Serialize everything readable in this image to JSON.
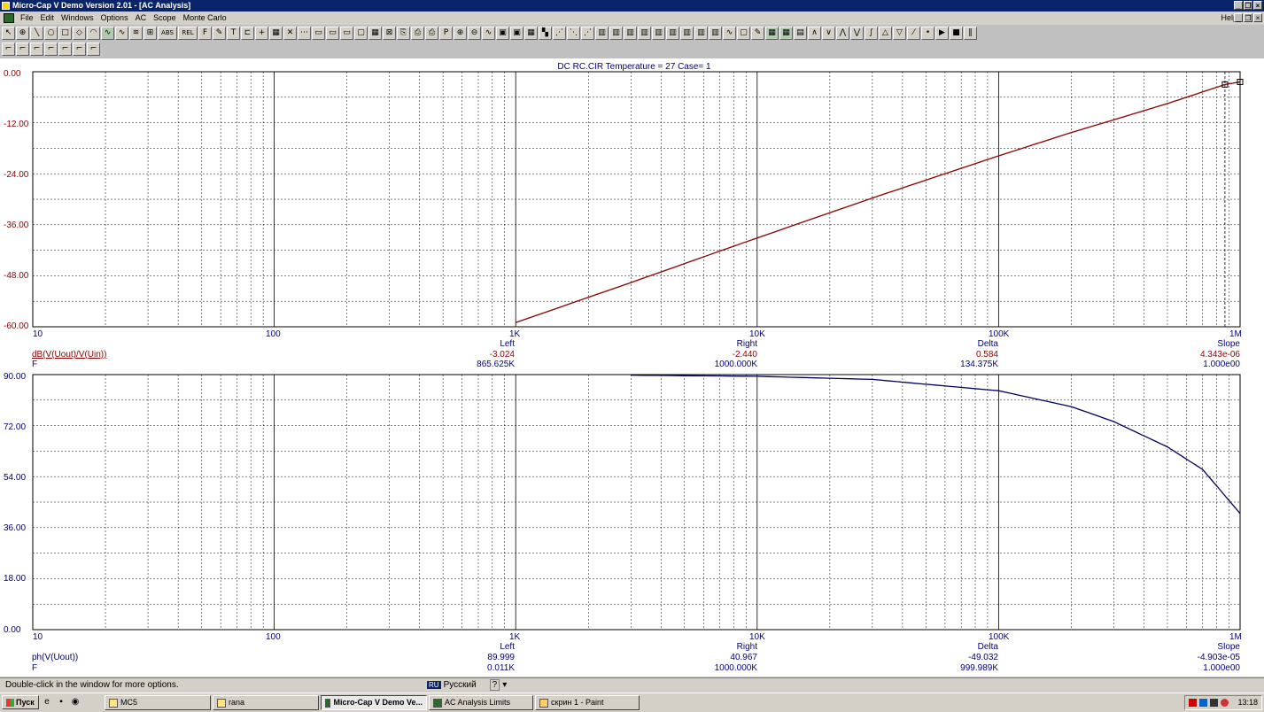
{
  "window": {
    "title": "Micro-Cap V Demo Version 2.01 - [AC Analysis]"
  },
  "menu": {
    "items": [
      "File",
      "Edit",
      "Windows",
      "Options",
      "AC",
      "Scope",
      "Monte Carlo"
    ],
    "help": "Help"
  },
  "toolbar": {
    "row1_icons": [
      "select-icon",
      "component-icon",
      "wire-icon",
      "circle-icon",
      "rect-icon",
      "diamond-icon",
      "arc-icon",
      "ac-icon",
      "wave-icon",
      "active-icon",
      "graph-icon",
      "abs-icon",
      "rel-icon",
      "f-icon",
      "pen-icon",
      "text-icon",
      "step-icon",
      "plus-icon",
      "grid-icon",
      "cross-icon",
      "dots-icon",
      "panel-icon",
      "panel2-icon",
      "panel3-icon",
      "frame-icon",
      "grid2-icon",
      "delete-icon",
      "copy-icon",
      "print-icon",
      "printer2-icon",
      "p-icon",
      "zoom-in-icon",
      "zoom-out-icon",
      "wave2-icon",
      "scope-icon",
      "scope2-icon",
      "table-icon",
      "chart-icon",
      "points-icon",
      "points2-icon",
      "points3-icon",
      "bars-icon",
      "bars2-icon",
      "bars3-icon",
      "bars4-icon",
      "bars5-icon",
      "bars6-icon",
      "bars7-icon",
      "bars8-icon",
      "bars9-icon",
      "curve-icon",
      "box-icon",
      "pencil-icon",
      "green1-icon",
      "green2-icon",
      "panel4-icon",
      "peak-icon",
      "valley-icon",
      "hi-icon",
      "lo-icon",
      "inflect-icon",
      "gmax-icon",
      "gmin-icon",
      "slope-icon",
      "point-icon",
      "run-icon",
      "stop-icon",
      "pause-icon"
    ],
    "row1_labels": {
      "abs": "ABS",
      "rel": "REL",
      "f": "F",
      "p": "P"
    },
    "row2_icons": [
      "cursor1-icon",
      "cursor2-icon",
      "cursor3-icon",
      "cursor4-icon",
      "cursor5-icon",
      "cursor6-icon",
      "cursor7-icon"
    ]
  },
  "top_plot": {
    "header": "DC  RC.CIR Temperature = 27 Case= 1",
    "y_ticks": [
      "0.00",
      "-12.00",
      "-24.00",
      "-36.00",
      "-48.00",
      "-60.00"
    ],
    "x_ticks": [
      "10",
      "100",
      "1K",
      "10K",
      "100K",
      "1M"
    ],
    "expr_y": "dB(V(Uout)/V(Uin))",
    "expr_x": "F",
    "measure_headers": [
      "Left",
      "Right",
      "Delta",
      "Slope"
    ],
    "measure_y": [
      "-3.024",
      "-2.440",
      "0.584",
      "4.343e-06"
    ],
    "measure_x": [
      "865.625K",
      "1000.000K",
      "134.375K",
      "1.000e00"
    ]
  },
  "bottom_plot": {
    "y_ticks": [
      "90.00",
      "72.00",
      "54.00",
      "36.00",
      "18.00",
      "0.00"
    ],
    "x_ticks": [
      "10",
      "100",
      "1K",
      "10K",
      "100K",
      "1M"
    ],
    "expr_y": "ph(V(Uout))",
    "expr_x": "F",
    "measure_headers": [
      "Left",
      "Right",
      "Delta",
      "Slope"
    ],
    "measure_y": [
      "89.999",
      "40.967",
      "-49.032",
      "-4.903e-05"
    ],
    "measure_x": [
      "0.011K",
      "1000.000K",
      "999.989K",
      "1.000e00"
    ]
  },
  "chart_data": [
    {
      "type": "line",
      "xscale": "log",
      "xlim": [
        10,
        1000000
      ],
      "ylim": [
        -60,
        0
      ],
      "ylabel": "dB(V(Uout)/V(Uin))",
      "xlabel": "F",
      "grid": true,
      "series": [
        {
          "name": "dB(V(Uout)/V(Uin))",
          "color": "#8b0000",
          "x": [
            1000,
            3000,
            10000,
            30000,
            100000,
            200000,
            300000,
            500000,
            865625,
            1000000
          ],
          "y": [
            -59.0,
            -49.6,
            -39.1,
            -29.7,
            -19.8,
            -14.3,
            -11.3,
            -7.5,
            -3.0,
            -2.4
          ]
        }
      ],
      "cursors_x": [
        865625,
        1000000
      ]
    },
    {
      "type": "line",
      "xscale": "log",
      "xlim": [
        10,
        1000000
      ],
      "ylim": [
        0,
        90
      ],
      "ylabel": "ph(V(Uout))",
      "xlabel": "F",
      "grid": true,
      "series": [
        {
          "name": "ph(V(Uout))",
          "color": "#000060",
          "x": [
            3000,
            10000,
            30000,
            100000,
            200000,
            300000,
            500000,
            700000,
            1000000
          ],
          "y": [
            89.8,
            89.4,
            88.3,
            84.3,
            78.7,
            73.4,
            64.5,
            56.5,
            41.0
          ]
        }
      ]
    }
  ],
  "status": {
    "message": "Double-click in the window for more options.",
    "lang": "Русский",
    "lang_code": "RU"
  },
  "taskbar": {
    "start": "Пуск",
    "buttons": [
      "MC5",
      "rana",
      "Micro-Cap V Demo Ve...",
      "AC Analysis Limits",
      "скрин 1 - Paint"
    ],
    "clock": "13:18"
  }
}
